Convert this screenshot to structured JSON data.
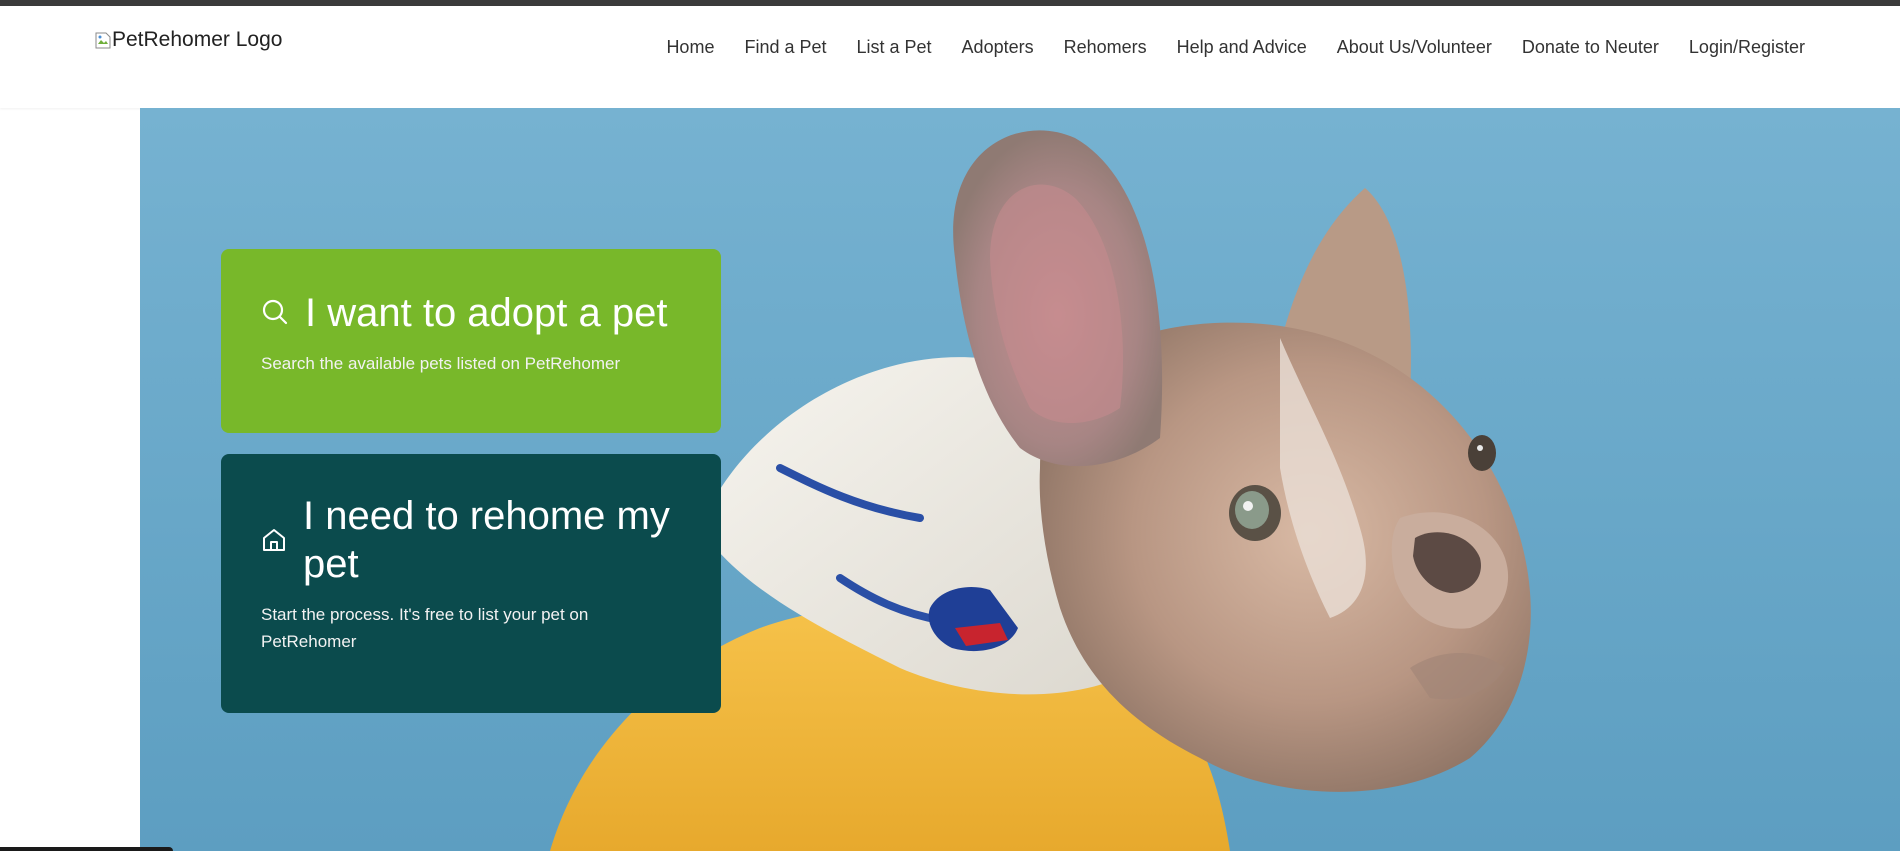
{
  "header": {
    "logo_alt": "PetRehomer Logo",
    "nav": [
      {
        "label": "Home"
      },
      {
        "label": "Find a Pet"
      },
      {
        "label": "List a Pet"
      },
      {
        "label": "Adopters"
      },
      {
        "label": "Rehomers"
      },
      {
        "label": "Help and Advice"
      },
      {
        "label": "About Us/Volunteer"
      },
      {
        "label": "Donate to Neuter"
      },
      {
        "label": "Login/Register"
      }
    ]
  },
  "hero": {
    "adopt": {
      "icon": "search-icon",
      "title": "I want to adopt a pet",
      "subtitle": "Search the available pets listed on PetRehomer"
    },
    "rehome": {
      "icon": "home-icon",
      "title": "I need to rehome my pet",
      "subtitle": "Start the process. It's free to list your pet on PetRehomer"
    }
  },
  "colors": {
    "adopt_card": "#78b82a",
    "rehome_card": "#0b4b4d",
    "hero_background": "#6aa9ca"
  }
}
